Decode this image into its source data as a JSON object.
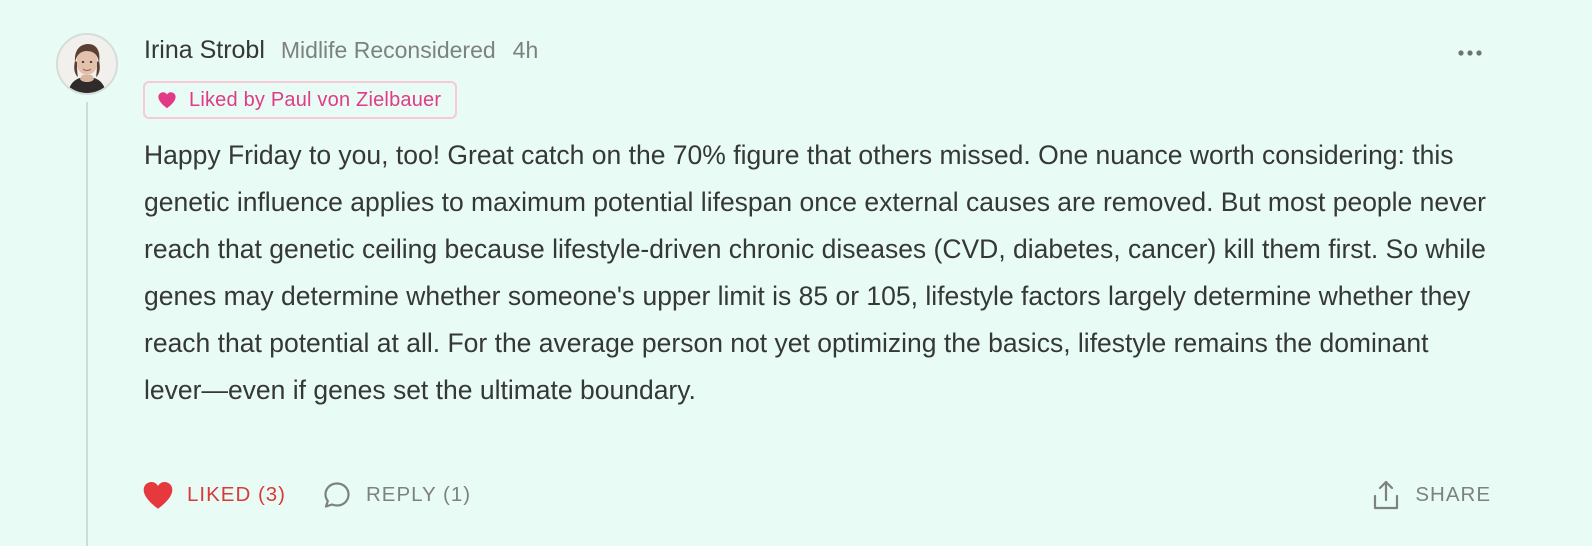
{
  "comment": {
    "author": "Irina Strobl",
    "publication": "Midlife Reconsidered",
    "timestamp": "4h",
    "liked_by_badge": "Liked by Paul von Zielbauer",
    "body": "Happy Friday to you, too! Great catch on the 70% figure that others missed. One nuance worth considering: this genetic influence applies to maximum potential lifespan once external causes are removed. But most people never reach that genetic ceiling because lifestyle-driven chronic diseases (CVD, diabetes, cancer) kill them first. So while genes may determine whether someone's upper limit is 85 or 105, lifestyle factors largely determine whether they reach that potential at all. For the average person not yet optimizing the basics, lifestyle remains the dominant lever—even if genes set the ultimate boundary.",
    "actions": {
      "like_label": "LIKED (3)",
      "reply_label": "REPLY (1)",
      "share_label": "SHARE"
    }
  },
  "icons": {
    "more": "more-horizontal-icon",
    "heart_small": "heart-icon",
    "like": "heart-filled-icon",
    "reply": "speech-bubble-icon",
    "share": "share-upload-icon"
  },
  "colors": {
    "background": "#e8fbf4",
    "text": "#363737",
    "muted": "#7d8280",
    "liked_red": "#d93a3a",
    "badge_pink": "#e23a86",
    "badge_border": "#f7c9d9"
  }
}
